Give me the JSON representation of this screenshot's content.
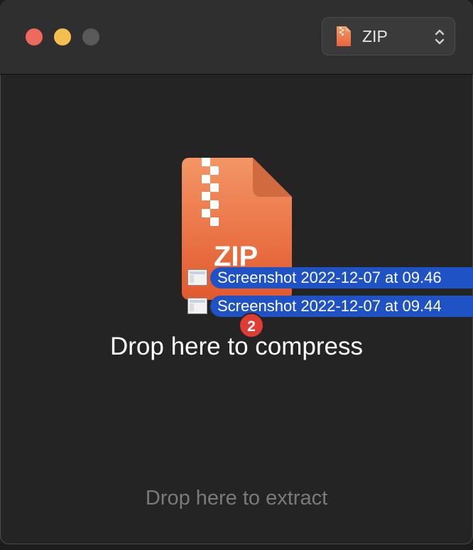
{
  "toolbar": {
    "format_label": "ZIP",
    "format_icon": "zip-file-icon"
  },
  "drop_zones": {
    "compress_text": "Drop here to compress",
    "extract_text": "Drop here to extract"
  },
  "archive_icon": {
    "label": "ZIP",
    "icon": "zip-archive-icon"
  },
  "dragged_files": {
    "count": "2",
    "items": [
      {
        "name": "Screenshot 2022-12-07 at 09.46",
        "icon": "image-file-icon"
      },
      {
        "name": "Screenshot 2022-12-07 at 09.44",
        "icon": "image-file-icon"
      }
    ]
  },
  "colors": {
    "accent": "#1f52c4",
    "zip_orange": "#ee7a48",
    "badge": "#e03c36",
    "close": "#ec6a5e",
    "minimize": "#f4bf4f"
  }
}
